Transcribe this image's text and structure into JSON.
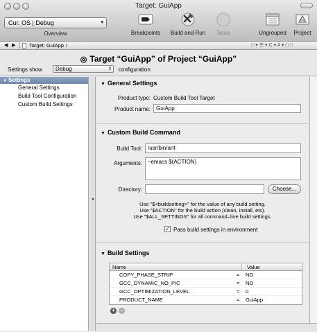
{
  "window": {
    "title": "Target: GuiApp"
  },
  "toolbar": {
    "overview_value": "Cur. OS | Debug",
    "overview_label": "Overview",
    "breakpoints_label": "Breakpoints",
    "build_run_label": "Build and Run",
    "tasks_label": "Tasks",
    "ungrouped_label": "Ungrouped",
    "project_label": "Project"
  },
  "pathbar": {
    "path": "Target: GuiApp ↕"
  },
  "header": {
    "title": "Target “GuiApp” of Project “GuiApp”",
    "settings_show_label": "Settings show",
    "config_value": "Debug",
    "configuration_label": "configuration"
  },
  "sidebar": {
    "header": "Settings",
    "items": [
      {
        "label": "General Settings"
      },
      {
        "label": "Build Tool Configuration"
      },
      {
        "label": "Custom Build Settings"
      }
    ]
  },
  "general": {
    "title": "General Settings",
    "product_type_label": "Product type:",
    "product_type_value": "Custom Build Tool Target",
    "product_name_label": "Product name:",
    "product_name_value": "GuiApp"
  },
  "custom_build": {
    "title": "Custom Build Command",
    "build_tool_label": "Build Tool:",
    "build_tool_value": "/usr/bin/ant",
    "arguments_label": "Arguments:",
    "arguments_value": "–emacs $(ACTION)",
    "directory_label": "Directory:",
    "directory_value": "",
    "choose_label": "Choose...",
    "help_lines": [
      "Use \"$<buildsetting>\" for the value of any build setting.",
      "Use \"$ACTION\" for the build action (clean, install, etc).",
      "Use \"$ALL_SETTINGS\" for all command–line build settings."
    ],
    "pass_settings_label": "Pass build settings in environment",
    "pass_settings_checked": true
  },
  "build_settings": {
    "title": "Build Settings",
    "col_name": "Name",
    "col_value": "Value",
    "rows": [
      {
        "name": "COPY_PHASE_STRIP",
        "eq": "=",
        "value": "NO"
      },
      {
        "name": "GCC_DYNAMIC_NO_PIC",
        "eq": "=",
        "value": "NO"
      },
      {
        "name": "GCC_OPTIMIZATION_LEVEL",
        "eq": "=",
        "value": "0"
      },
      {
        "name": "PRODUCT_NAME",
        "eq": "=",
        "value": "GuiApp"
      }
    ]
  }
}
